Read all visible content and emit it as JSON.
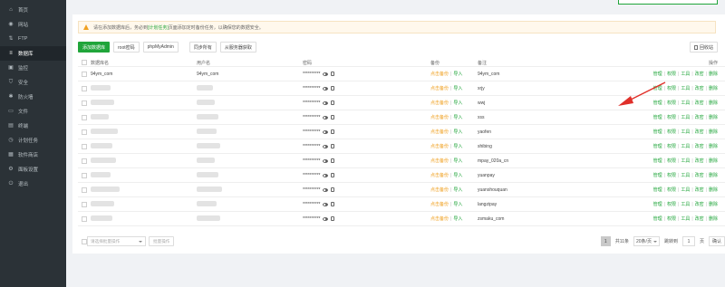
{
  "sidebar": {
    "items": [
      {
        "label": "首页",
        "icon": "home-icon",
        "glyph": "⌂"
      },
      {
        "label": "网站",
        "icon": "globe-icon",
        "glyph": "◉"
      },
      {
        "label": "FTP",
        "icon": "ftp-icon",
        "glyph": "⇅"
      },
      {
        "label": "数据库",
        "icon": "database-icon",
        "glyph": "≡",
        "active": true
      },
      {
        "label": "监控",
        "icon": "monitor-icon",
        "glyph": "▣"
      },
      {
        "label": "安全",
        "icon": "shield-icon",
        "glyph": "⛉"
      },
      {
        "label": "防火墙",
        "icon": "firewall-icon",
        "glyph": "✱"
      },
      {
        "label": "文件",
        "icon": "folder-icon",
        "glyph": "▭"
      },
      {
        "label": "终端",
        "icon": "terminal-icon",
        "glyph": "▤"
      },
      {
        "label": "计划任务",
        "icon": "clock-icon",
        "glyph": "◷"
      },
      {
        "label": "软件商店",
        "icon": "grid-icon",
        "glyph": "▦"
      },
      {
        "label": "面板设置",
        "icon": "gear-icon",
        "glyph": "⚙"
      },
      {
        "label": "退出",
        "icon": "logout-icon",
        "glyph": "⏻"
      }
    ]
  },
  "notice": {
    "text_before": "请在添加数据库后，务必到",
    "link": "[计划任务]",
    "text_after": "页面添加定时备份任务，以确保您的数据安全。"
  },
  "toolbar": {
    "add_label": "添加数据库",
    "root_label": "root密码",
    "phpmyadmin_label": "phpMyAdmin",
    "sync_all_label": "同步所有",
    "get_from_server_label": "从服务器获取",
    "recycle_label": "回收站"
  },
  "table": {
    "headers": {
      "name": "数据库名",
      "user": "用户名",
      "password": "密码",
      "backup": "备份",
      "note": "备注",
      "ops": "操作"
    },
    "backup_label": "点击备份",
    "import_label": "导入",
    "op_labels": [
      "管理",
      "权限",
      "工具",
      "改密",
      "删除"
    ],
    "rows": [
      {
        "name": "94ym_com",
        "user": "94ym_com",
        "pwd": "**********",
        "note": "94ym_com"
      },
      {
        "name": "",
        "user": "",
        "pwd": "**********",
        "note": "xrjy"
      },
      {
        "name": "",
        "user": "",
        "pwd": "**********",
        "note": "wwj"
      },
      {
        "name": "",
        "user": "",
        "pwd": "**********",
        "note": "xss"
      },
      {
        "name": "",
        "user": "",
        "pwd": "**********",
        "note": "yaofen"
      },
      {
        "name": "",
        "user": "",
        "pwd": "**********",
        "note": "shibing"
      },
      {
        "name": "",
        "user": "",
        "pwd": "**********",
        "note": "mpay_020a_cn"
      },
      {
        "name": "",
        "user": "",
        "pwd": "**********",
        "note": "yuanpay"
      },
      {
        "name": "",
        "user": "",
        "pwd": "**********",
        "note": "yuanshouquan"
      },
      {
        "name": "",
        "user": "",
        "pwd": "**********",
        "note": "langzipay"
      },
      {
        "name": "",
        "user": "",
        "pwd": "**********",
        "note": "zsmaku_com"
      }
    ]
  },
  "footer": {
    "batch_placeholder": "请选择批量操作",
    "batch_button": "批量操作",
    "page": "1",
    "total": "共11条",
    "per_page": "20条/页",
    "jump_label": "跳转到",
    "jump_value": "1",
    "page_unit": "页",
    "confirm": "确认"
  },
  "colors": {
    "sidebar_bg": "#2b3237",
    "accent_green": "#20a53a",
    "backup_orange": "#f0a020",
    "annotation_red": "#e0302a"
  }
}
